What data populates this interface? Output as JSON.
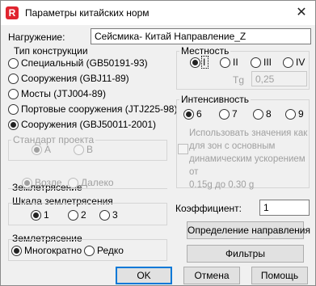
{
  "window": {
    "title": "Параметры китайских норм",
    "icon": "revit-app-icon",
    "close_glyph": "✕"
  },
  "load": {
    "label": "Нагружение:",
    "value": "Сейсмика- Китай Направление_Z"
  },
  "construction_type": {
    "title": "Тип конструкции",
    "options": [
      {
        "label": "Специальный (GB50191-93)",
        "selected": false
      },
      {
        "label": "Сооружения (GBJ11-89)",
        "selected": false
      },
      {
        "label": "Мосты (JTJ004-89)",
        "selected": false
      },
      {
        "label": "Портовые сооружения (JTJ225-98)",
        "selected": false
      },
      {
        "label": "Сооружения (GBJ50011-2001)",
        "selected": true
      }
    ]
  },
  "standard": {
    "title": "Стандарт проекта",
    "options": [
      {
        "label": "A",
        "selected": true
      },
      {
        "label": "B",
        "selected": false
      }
    ]
  },
  "earthquake_zone": {
    "title": "Землетрясение",
    "options": [
      {
        "label": "Возле",
        "selected": true
      },
      {
        "label": "Далеко",
        "selected": false
      }
    ]
  },
  "scale": {
    "title": "Шкала землетрясения",
    "options": [
      {
        "label": "1",
        "selected": true
      },
      {
        "label": "2",
        "selected": false
      },
      {
        "label": "3",
        "selected": false
      }
    ]
  },
  "earthquake": {
    "title": "Землетрясение",
    "options": [
      {
        "label": "Многократно",
        "selected": true
      },
      {
        "label": "Редко",
        "selected": false
      }
    ]
  },
  "locality": {
    "title": "Местность",
    "options": [
      {
        "label": "I",
        "selected": true
      },
      {
        "label": "II",
        "selected": false
      },
      {
        "label": "III",
        "selected": false
      },
      {
        "label": "IV",
        "selected": false
      }
    ],
    "tg_label": "Tg",
    "tg_value": "0,25"
  },
  "intensity": {
    "title": "Интенсивность",
    "options": [
      {
        "label": "6",
        "selected": true
      },
      {
        "label": "7",
        "selected": false
      },
      {
        "label": "8",
        "selected": false
      },
      {
        "label": "9",
        "selected": false
      }
    ],
    "checkbox_label_lines": [
      "Использовать значения как",
      "для зон с основным",
      "динамическим ускорением от",
      "0.15g до 0.30 g"
    ]
  },
  "coefficient": {
    "label": "Коэффициент:",
    "value": "1"
  },
  "buttons": {
    "direction": "Определение направления",
    "filters": "Фильтры",
    "ok": "OK",
    "cancel": "Отмена",
    "help": "Помощь"
  }
}
